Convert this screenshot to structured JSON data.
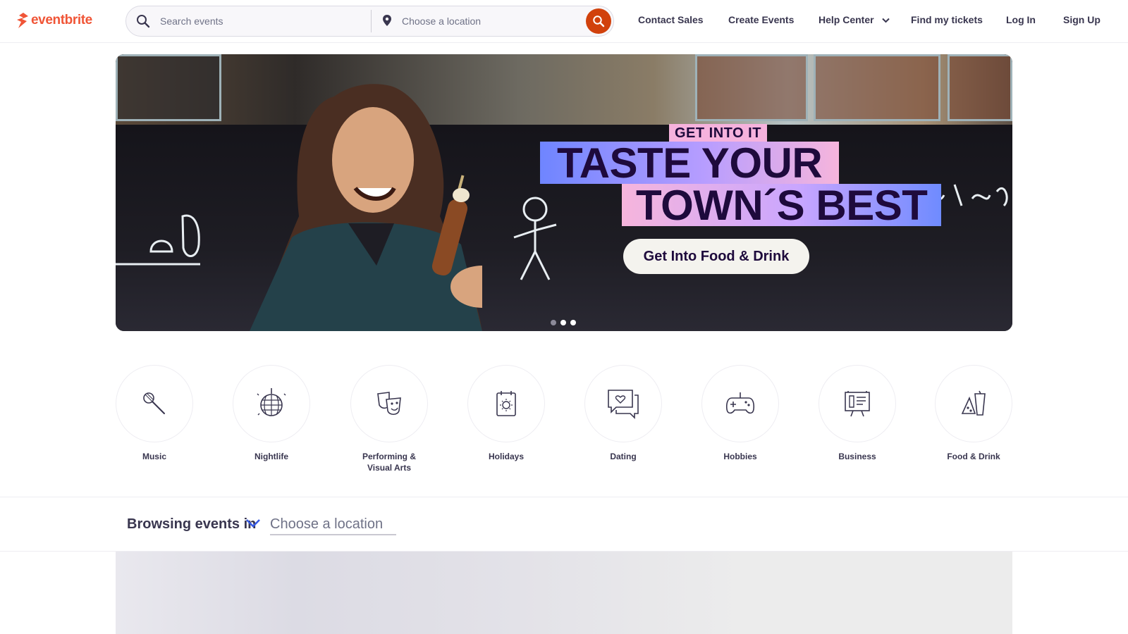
{
  "header": {
    "brand": "eventbrite",
    "brand_color": "#f05537",
    "search": {
      "placeholder": "Search events"
    },
    "location": {
      "placeholder": "Choose a location"
    },
    "search_button_color": "#d1410c",
    "nav": [
      {
        "label": "Contact Sales"
      },
      {
        "label": "Create Events"
      },
      {
        "label": "Help Center"
      },
      {
        "label": "Find my tickets"
      },
      {
        "label": "Log In"
      },
      {
        "label": "Sign Up"
      }
    ]
  },
  "hero": {
    "eyebrow": "GET INTO IT",
    "headline_line1": "TASTE YOUR",
    "headline_line2": "TOWN´S BEST",
    "cta_label": "Get Into Food & Drink",
    "slides": 3,
    "active_slide": 1
  },
  "categories": [
    {
      "label": "Music",
      "icon": "microphone-icon"
    },
    {
      "label": "Nightlife",
      "icon": "disco-ball-icon"
    },
    {
      "label": "Performing & Visual Arts",
      "icon": "theater-masks-icon"
    },
    {
      "label": "Holidays",
      "icon": "calendar-icon"
    },
    {
      "label": "Dating",
      "icon": "chat-heart-icon"
    },
    {
      "label": "Hobbies",
      "icon": "gamepad-icon"
    },
    {
      "label": "Business",
      "icon": "presentation-board-icon"
    },
    {
      "label": "Food & Drink",
      "icon": "food-drink-icon"
    }
  ],
  "browse": {
    "label": "Browsing events in",
    "location_placeholder": "Choose a location"
  }
}
